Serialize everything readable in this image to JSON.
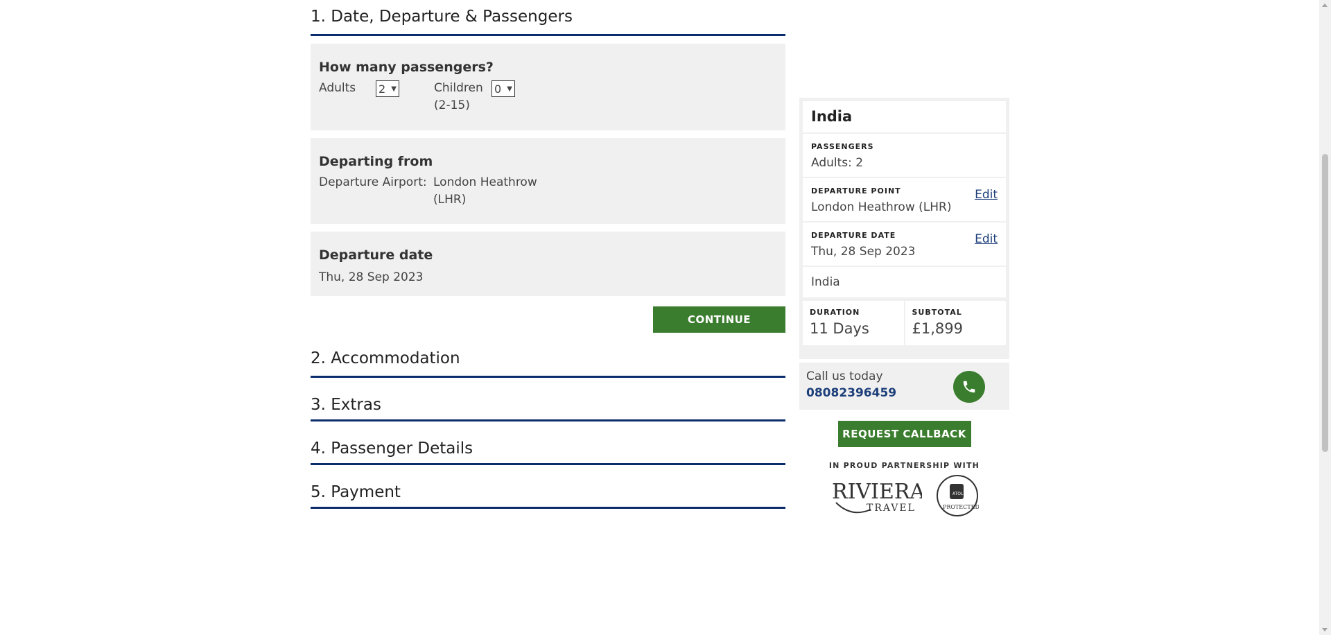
{
  "steps": {
    "step1": "1. Date, Departure & Passengers",
    "step2": "2. Accommodation",
    "step3": "3. Extras",
    "step4": "4. Passenger Details",
    "step5": "5. Payment"
  },
  "passengers": {
    "title": "How many passengers?",
    "adults_label": "Adults",
    "adults_value": "2",
    "children_label": "Children",
    "children_age": "(2-15)",
    "children_value": "0"
  },
  "departing": {
    "title": "Departing from",
    "airport_label": "Departure Airport:",
    "airport_value_line1": "London Heathrow",
    "airport_value_line2": "(LHR)"
  },
  "departure_date": {
    "title": "Departure date",
    "value": "Thu, 28 Sep 2023"
  },
  "continue_label": "CONTINUE",
  "summary": {
    "destination_title": "India",
    "passengers_label": "PASSENGERS",
    "passengers_value": "Adults: 2",
    "departure_point_label": "DEPARTURE POINT",
    "departure_point_value": "London Heathrow (LHR)",
    "departure_date_label": "DEPARTURE DATE",
    "departure_date_value": "Thu, 28 Sep 2023",
    "edit_label": "Edit",
    "destination": "India",
    "duration_label": "DURATION",
    "duration_value": "11 Days",
    "subtotal_label": "SUBTOTAL",
    "subtotal_value": "£1,899"
  },
  "call": {
    "label": "Call us today",
    "number": "08082396459"
  },
  "callback_label": "REQUEST CALLBACK",
  "partnership_label": "IN PROUD PARTNERSHIP WITH",
  "logos": {
    "riviera_main": "RIVIERA",
    "riviera_sub": "TRAVEL",
    "atol_top": "ATOL",
    "atol_bottom": "PROTECTED"
  },
  "colors": {
    "navy": "#0b2d6b",
    "green": "#3b7d2e",
    "panel_bg": "#f0f0f0",
    "link": "#1d3f7a"
  }
}
